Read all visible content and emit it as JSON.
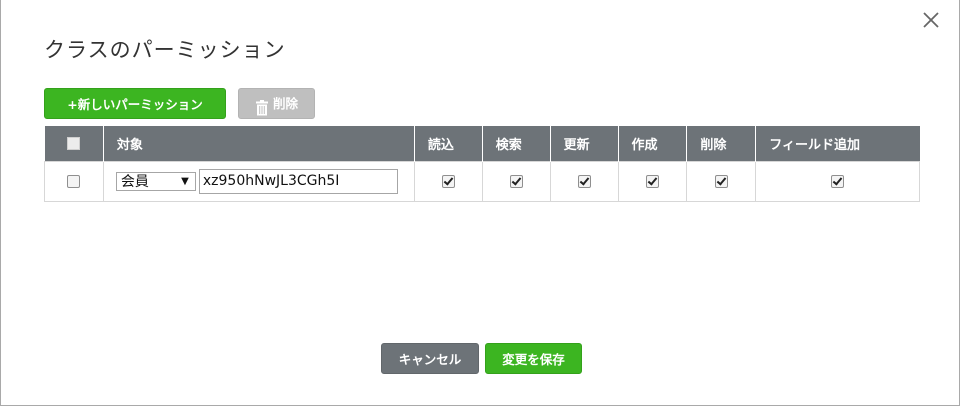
{
  "dialog": {
    "title": "クラスのパーミッション",
    "close_icon": "close-icon"
  },
  "toolbar": {
    "add_label": "+新しいパーミッション",
    "delete_label": "削除",
    "delete_icon": "trash-icon"
  },
  "table": {
    "headers": {
      "target": "対象",
      "read": "読込",
      "search": "検索",
      "update": "更新",
      "create": "作成",
      "delete": "削除",
      "add_field": "フィールド追加"
    },
    "rows": [
      {
        "selected": false,
        "target_type": "会員",
        "target_value": "xz950hNwJL3CGh5I",
        "read": true,
        "search": true,
        "update": true,
        "create": true,
        "delete": true,
        "add_field": true
      }
    ]
  },
  "footer": {
    "cancel_label": "キャンセル",
    "save_label": "変更を保存"
  },
  "colors": {
    "primary_green": "#3cb521",
    "header_gray": "#6d7378",
    "disabled_gray": "#bfbfbf"
  }
}
